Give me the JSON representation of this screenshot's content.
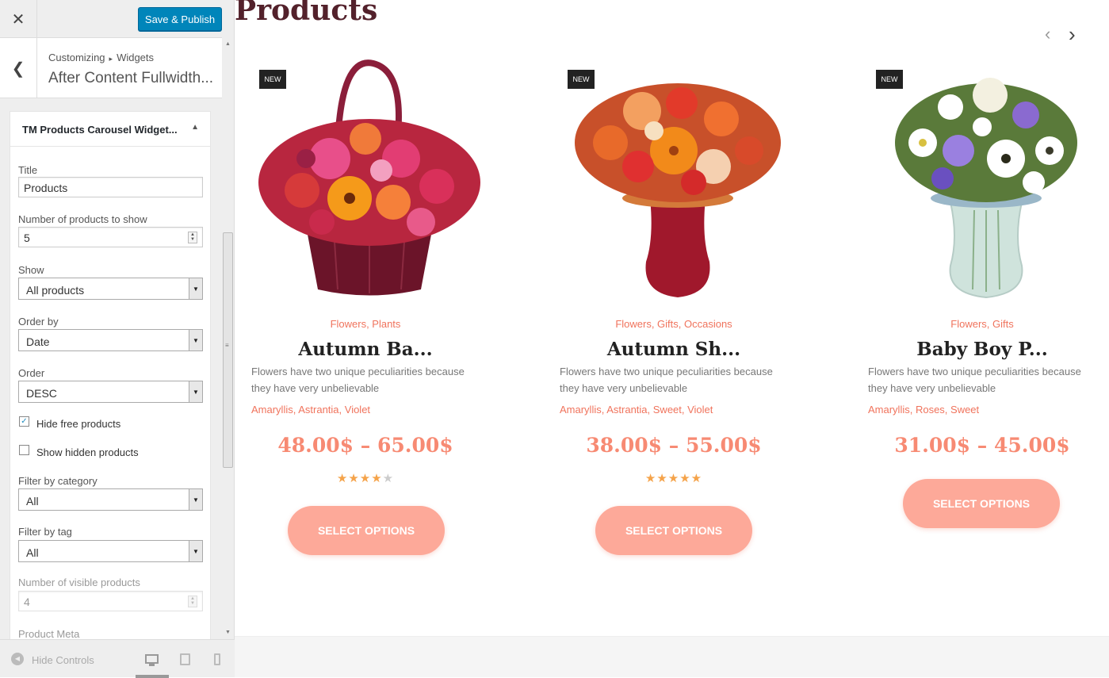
{
  "topbar": {
    "close_icon": "close-icon",
    "publish_label": "Save & Publish"
  },
  "crumb": {
    "part1": "Customizing",
    "separator": "▸",
    "part2": "Widgets",
    "section_title": "After Content Fullwidth..."
  },
  "widget": {
    "title": "TM Products Carousel Widget...",
    "fields": {
      "title_label": "Title",
      "title_value": "Products",
      "count_label": "Number of products to show",
      "count_value": "5",
      "show_label": "Show",
      "show_value": "All products",
      "orderby_label": "Order by",
      "orderby_value": "Date",
      "order_label": "Order",
      "order_value": "DESC",
      "hide_free_label": "Hide free products",
      "hide_free_checked": true,
      "show_hidden_label": "Show hidden products",
      "show_hidden_checked": false,
      "filter_cat_label": "Filter by category",
      "filter_cat_value": "All",
      "filter_tag_label": "Filter by tag",
      "filter_tag_value": "All",
      "visible_label": "Number of visible products",
      "visible_value": "4",
      "meta_label": "Product Meta"
    }
  },
  "footer": {
    "hide_controls": "Hide Controls"
  },
  "preview": {
    "heading": "Products",
    "products": [
      {
        "badge": "NEW",
        "categories": "Flowers, Plants",
        "name": "Autumn Ba...",
        "description": "Flowers have two unique peculiarities because they have very unbelievable",
        "tags": "Amaryllis, Astrantia, Violet",
        "price": "48.00$ – 65.00$",
        "rating": 4,
        "button": "SELECT OPTIONS"
      },
      {
        "badge": "NEW",
        "categories": "Flowers, Gifts, Occasions",
        "name": "Autumn Sh...",
        "description": "Flowers have two unique peculiarities because they have very unbelievable",
        "tags": "Amaryllis, Astrantia, Sweet, Violet",
        "price": "38.00$ – 55.00$",
        "rating": 5,
        "button": "SELECT OPTIONS"
      },
      {
        "badge": "NEW",
        "categories": "Flowers, Gifts",
        "name": "Baby Boy P...",
        "description": "Flowers have two unique peculiarities because they have very unbelievable",
        "tags": "Amaryllis, Roses, Sweet",
        "price": "31.00$ – 45.00$",
        "rating": 0,
        "button": "SELECT OPTIONS"
      }
    ]
  },
  "colors": {
    "accent": "#f0735c",
    "button": "#fda999",
    "publish": "#0085ba",
    "heading": "#53212b"
  }
}
